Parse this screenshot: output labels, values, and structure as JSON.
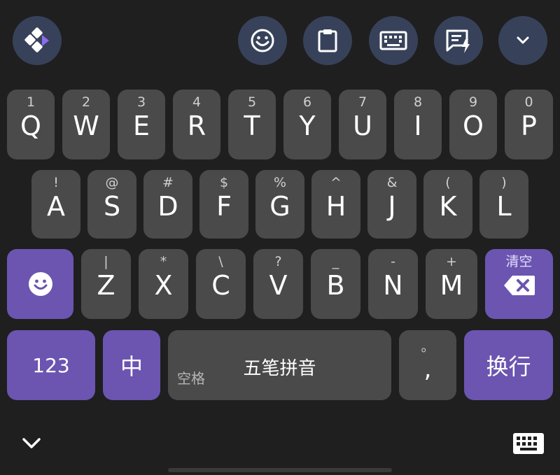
{
  "toolbar": {
    "logo_icon": "app-logo-icon",
    "buttons": [
      {
        "name": "emoji-icon"
      },
      {
        "name": "clipboard-icon"
      },
      {
        "name": "keyboard-icon"
      },
      {
        "name": "quick-phrase-icon"
      },
      {
        "name": "chevron-down-icon"
      }
    ]
  },
  "colors": {
    "background": "#1f1f1f",
    "key": "#4a4a4a",
    "accent": "#6b55b0",
    "toolbar_button": "#37425a"
  },
  "row1": [
    {
      "main": "Q",
      "sub": "1"
    },
    {
      "main": "W",
      "sub": "2"
    },
    {
      "main": "E",
      "sub": "3"
    },
    {
      "main": "R",
      "sub": "4"
    },
    {
      "main": "T",
      "sub": "5"
    },
    {
      "main": "Y",
      "sub": "6"
    },
    {
      "main": "U",
      "sub": "7"
    },
    {
      "main": "I",
      "sub": "8"
    },
    {
      "main": "O",
      "sub": "9"
    },
    {
      "main": "P",
      "sub": "0"
    }
  ],
  "row2": [
    {
      "main": "A",
      "sub": "!"
    },
    {
      "main": "S",
      "sub": "@"
    },
    {
      "main": "D",
      "sub": "#"
    },
    {
      "main": "F",
      "sub": "$"
    },
    {
      "main": "G",
      "sub": "%"
    },
    {
      "main": "H",
      "sub": "^"
    },
    {
      "main": "J",
      "sub": "&"
    },
    {
      "main": "K",
      "sub": "("
    },
    {
      "main": "L",
      "sub": ")"
    }
  ],
  "row3": [
    {
      "main": "Z",
      "sub": "|"
    },
    {
      "main": "X",
      "sub": "*"
    },
    {
      "main": "C",
      "sub": "\\"
    },
    {
      "main": "V",
      "sub": "?"
    },
    {
      "main": "B",
      "sub": "_"
    },
    {
      "main": "N",
      "sub": "-"
    },
    {
      "main": "M",
      "sub": "+"
    }
  ],
  "emoji_key": {
    "icon": "emoji-icon"
  },
  "backspace_key": {
    "sub": "清空",
    "icon": "backspace-icon"
  },
  "bottom_row": {
    "numbers_label": "123",
    "lang_label": "中",
    "space_hint": "空格",
    "space_label": "五笔拼音",
    "comma_main": ",",
    "comma_sub": "。",
    "enter_label": "换行"
  },
  "nav": {
    "left_icon": "chevron-down-icon",
    "right_icon": "keyboard-icon"
  }
}
